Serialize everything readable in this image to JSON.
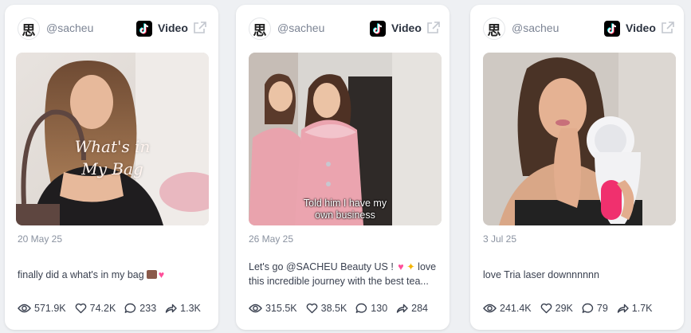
{
  "cards": [
    {
      "handle": "@sacheu",
      "platform": "Video",
      "avatar_glyph": "思",
      "overlay_text": [
        "What's in",
        "My Bag"
      ],
      "date": "20 May 25",
      "caption": [
        "finally did a what's in my bag"
      ],
      "caption_emoji": [
        "handbag",
        "heart"
      ],
      "stats": {
        "views": "571.9K",
        "likes": "74.2K",
        "comments": "233",
        "shares": "1.3K"
      }
    },
    {
      "handle": "@sacheu",
      "platform": "Video",
      "avatar_glyph": "思",
      "overlay_text": [
        "Told him I have my",
        "own business"
      ],
      "date": "26 May 25",
      "caption": [
        "Let's go @SACHEU Beauty US ! ",
        "this incredible journey with the best tea..."
      ],
      "caption_tail": "love",
      "caption_emoji": [
        "heart",
        "sparkles"
      ],
      "stats": {
        "views": "315.5K",
        "likes": "38.5K",
        "comments": "130",
        "shares": "284"
      }
    },
    {
      "handle": "@sacheu",
      "platform": "Video",
      "avatar_glyph": "思",
      "date": "3 Jul 25",
      "caption": [
        "love Tria laser downnnnnn"
      ],
      "stats": {
        "views": "241.4K",
        "likes": "29K",
        "comments": "79",
        "shares": "1.7K"
      }
    }
  ],
  "icons": {
    "platform": "tiktok-icon",
    "external": "external-link-icon",
    "views": "eye-icon",
    "likes": "heart-icon",
    "comments": "comment-icon",
    "shares": "share-icon"
  },
  "colors": {
    "accent_pink": "#ff4f9a",
    "muted_text": "#8a92a0",
    "body_text": "#3a4150"
  }
}
